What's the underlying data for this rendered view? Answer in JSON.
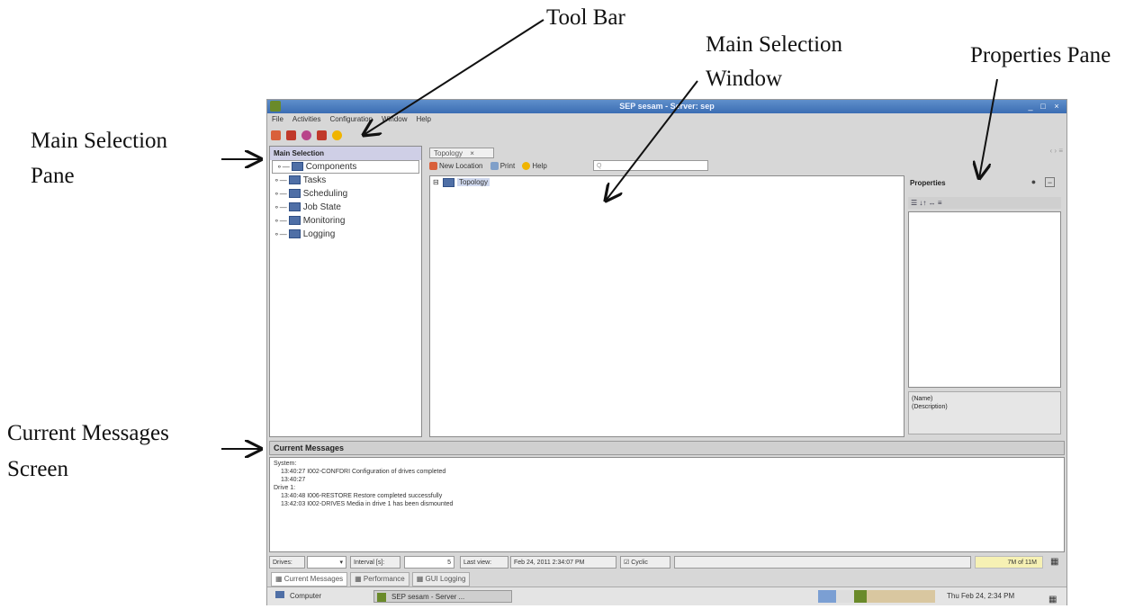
{
  "callouts": {
    "tool_bar": "Tool Bar",
    "main_selection_window": [
      "Main Selection",
      "Window"
    ],
    "properties_pane": "Properties Pane",
    "main_selection_pane": [
      "Main Selection",
      "Pane"
    ],
    "current_messages_screen": [
      "Current Messages",
      "Screen"
    ]
  },
  "window": {
    "title": "SEP sesam - Server: sep",
    "controls": [
      "_",
      "□",
      "×"
    ],
    "menu": [
      "File",
      "Activities",
      "Configuration",
      "Window",
      "Help"
    ]
  },
  "toolbar": {
    "buttons": [
      {
        "icon": "new-location-icon",
        "color": "#d9603a"
      },
      {
        "icon": "add-drive-icon",
        "color": "#c0392b"
      },
      {
        "icon": "refresh-icon",
        "color": "#b8458a"
      },
      {
        "icon": "stop-icon",
        "color": "#c0392b"
      },
      {
        "icon": "help-icon",
        "color": "#f0b400"
      }
    ]
  },
  "main_selection": {
    "header": "Main Selection",
    "items": [
      "Components",
      "Tasks",
      "Scheduling",
      "Job State",
      "Monitoring",
      "Logging"
    ]
  },
  "center": {
    "tab_label": "Topology",
    "tab_close": "×",
    "tab_nav": "‹ › ≡",
    "toolbar": {
      "new_location": "New Location",
      "print": "Print",
      "help": "Help",
      "search_placeholder": "Q"
    },
    "tree_root": "Topology"
  },
  "properties": {
    "title": "Properties",
    "toolbar_text": "☰ ↓↑   ↔ ≡",
    "name_label": "(Name)",
    "description_label": "(Description)"
  },
  "messages": {
    "header": "Current Messages",
    "lines": [
      {
        "text": "System:",
        "indent": false
      },
      {
        "text": "13:40:27  I002-CONFDRI Configuration of drives completed",
        "indent": true
      },
      {
        "text": "13:40:27",
        "indent": true
      },
      {
        "text": "Drive 1:",
        "indent": false
      },
      {
        "text": "13:40:48  I006-RESTORE Restore completed successfully",
        "indent": true
      },
      {
        "text": "13:42:03  I002-DRIVES  Media  in drive 1 has been dismounted",
        "indent": true
      }
    ]
  },
  "statusbar": {
    "drives_label": "Drives:",
    "interval_label": "Interval [s]:",
    "interval_value": "5",
    "last_view_label": "Last view:",
    "last_view_value": "Feb 24, 2011 2:34:07 PM",
    "cyclic_label": "Cyclic",
    "memory": "7M of 11M"
  },
  "bottom_tabs": [
    "Current Messages",
    "Performance",
    "GUI Logging"
  ],
  "taskbar": {
    "computer": "Computer",
    "app": "SEP sesam - Server ...",
    "clock": "Thu Feb 24,  2:34 PM"
  }
}
